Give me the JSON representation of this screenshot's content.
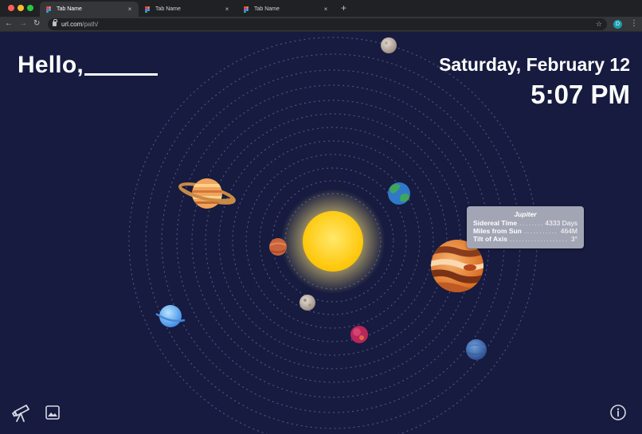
{
  "browser": {
    "tabs": [
      {
        "label": "Tab Name",
        "active": true
      },
      {
        "label": "Tab Name",
        "active": false
      },
      {
        "label": "Tab Name",
        "active": false
      }
    ],
    "close_glyph": "×",
    "new_tab_glyph": "+",
    "url_host": "url.com",
    "url_path": "/path/",
    "profile_initial": "D",
    "icons": [
      "back-arrow-icon",
      "forward-arrow-icon",
      "reload-icon",
      "lock-icon",
      "star-icon",
      "kebab-menu-icon"
    ],
    "colors": {
      "close": "#ff5f57",
      "minimize": "#febc2e",
      "maximize": "#28c840"
    }
  },
  "page": {
    "greeting": "Hello,",
    "date": "Saturday, February 12",
    "time": "5:07 PM",
    "background": "#161b3f",
    "tooltip": {
      "title": "Jupiter",
      "rows": [
        {
          "label": "Sidereal Time",
          "value": "4333 Days"
        },
        {
          "label": "Miles from Sun",
          "value": "464M"
        },
        {
          "label": "Tilt of Axis",
          "value": "3°"
        }
      ]
    },
    "planets": [
      "sun",
      "mercury",
      "venus",
      "mars",
      "earth",
      "jupiter",
      "saturn",
      "uranus",
      "neptune",
      "moon"
    ],
    "bottom_icons": [
      "telescope-icon",
      "image-icon",
      "info-icon"
    ]
  }
}
